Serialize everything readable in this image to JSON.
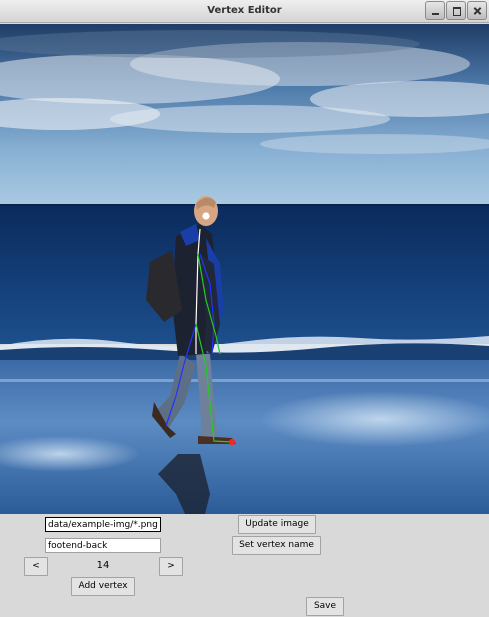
{
  "window": {
    "title": "Vertex Editor",
    "buttons": [
      "minimize",
      "maximize",
      "close"
    ]
  },
  "image": {
    "description_icon": "beach-photo-with-skeleton-overlay",
    "overlay_colors": {
      "spine": "#ffffff",
      "left_limbs": "#2233ff",
      "right_limbs": "#22cc22",
      "selected_vertex": "#ff2222"
    }
  },
  "controls": {
    "glob_input": "data/example-img/*.png",
    "vertex_name_input": "footend-back",
    "prev_label": "<",
    "next_label": ">",
    "vertex_index": "14",
    "add_vertex_label": "Add vertex",
    "update_image_label": "Update image",
    "set_vertex_name_label": "Set vertex name",
    "save_label": "Save"
  }
}
